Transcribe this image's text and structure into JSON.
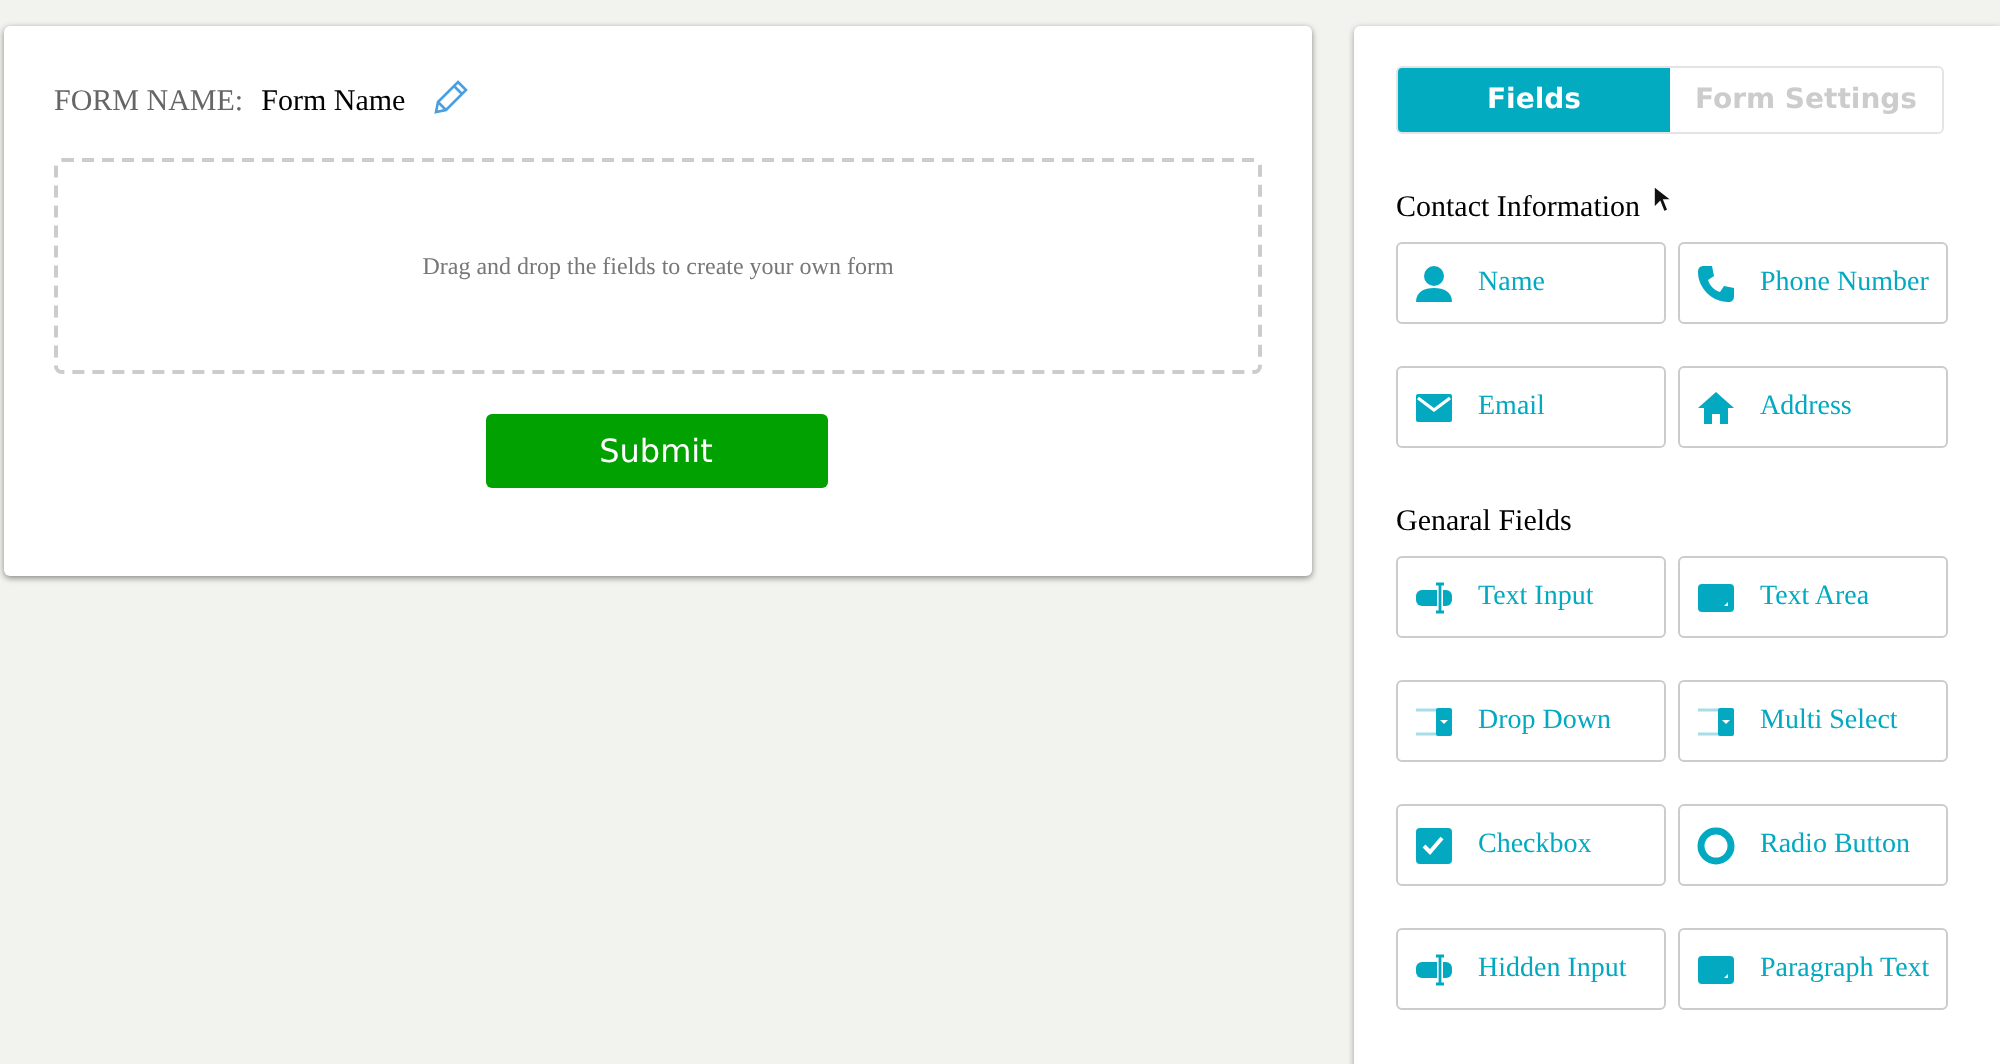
{
  "form": {
    "name_label": "FORM NAME:",
    "name_value": "Form Name",
    "drop_hint": "Drag and drop the fields to create your own form",
    "submit": "Submit"
  },
  "tabs": [
    {
      "label": "Fields",
      "selected": true
    },
    {
      "label": "Form Settings",
      "selected": false
    }
  ],
  "sections": [
    {
      "title": "Contact Information",
      "fields": [
        {
          "label": "Name",
          "kind": "person"
        },
        {
          "label": "Phone Number",
          "kind": "phone"
        },
        {
          "label": "Email",
          "kind": "mail"
        },
        {
          "label": "Address",
          "kind": "home"
        }
      ]
    },
    {
      "title": "Genaral Fields",
      "fields": [
        {
          "label": "Text Input",
          "kind": "input"
        },
        {
          "label": "Text Area",
          "kind": "area"
        },
        {
          "label": "Drop Down",
          "kind": "select"
        },
        {
          "label": "Multi Select",
          "kind": "select"
        },
        {
          "label": "Checkbox",
          "kind": "check"
        },
        {
          "label": "Radio Button",
          "kind": "radio"
        },
        {
          "label": "Hidden Input",
          "kind": "input"
        },
        {
          "label": "Paragraph Text",
          "kind": "area"
        }
      ]
    }
  ]
}
